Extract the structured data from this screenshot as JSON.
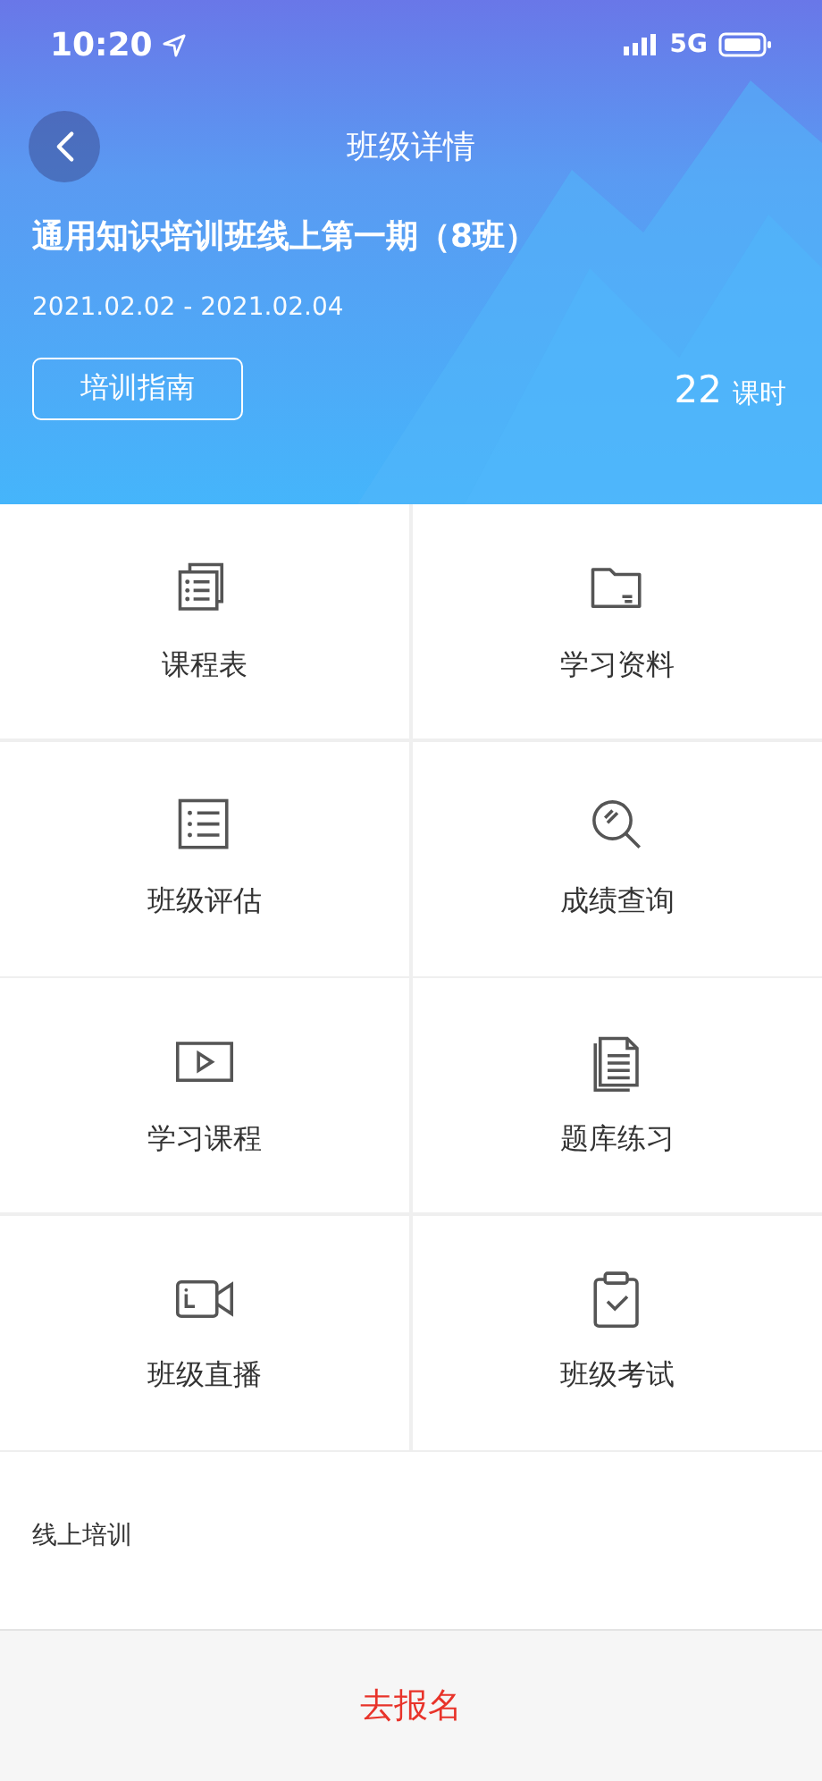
{
  "status_bar": {
    "time": "10:20",
    "network": "5G"
  },
  "header": {
    "title": "班级详情",
    "course_title": "通用知识培训班线上第一期（8班）",
    "dates": "2021.02.02 - 2021.02.04",
    "guide_button": "培训指南",
    "hours_value": "22",
    "hours_unit": "课时"
  },
  "menu": [
    {
      "label": "课程表",
      "kind": "schedule"
    },
    {
      "label": "学习资料",
      "kind": "folder"
    },
    {
      "label": "班级评估",
      "kind": "checklist"
    },
    {
      "label": "成绩查询",
      "kind": "search"
    },
    {
      "label": "学习课程",
      "kind": "video"
    },
    {
      "label": "题库练习",
      "kind": "document"
    },
    {
      "label": "班级直播",
      "kind": "camera"
    },
    {
      "label": "班级考试",
      "kind": "clipboard"
    }
  ],
  "section": {
    "text": "线上培训"
  },
  "action_button": "去报名"
}
